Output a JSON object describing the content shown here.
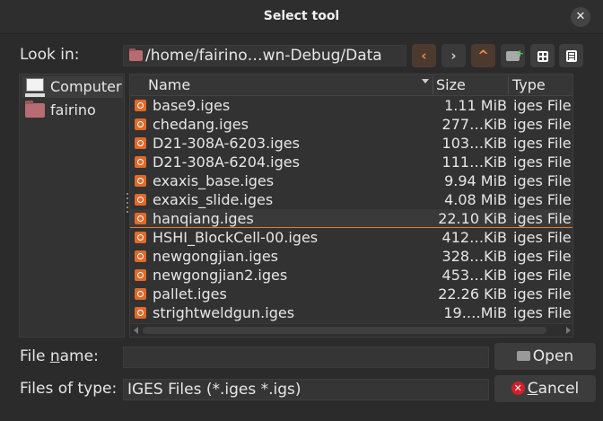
{
  "window": {
    "title": "Select tool"
  },
  "look_in": {
    "label": "Look in:",
    "path": "/home/fairino…wn-Debug/Data"
  },
  "toolbar": {
    "back": "‹",
    "forward": "›",
    "up": "^"
  },
  "sidebar": {
    "items": [
      {
        "label": "Computer",
        "icon": "computer-icon"
      },
      {
        "label": "fairino",
        "icon": "home-folder-icon"
      }
    ]
  },
  "columns": {
    "name": "Name",
    "size": "Size",
    "type": "Type"
  },
  "files": [
    {
      "name": "base9.iges",
      "size": "1.11 MiB",
      "type": "iges File"
    },
    {
      "name": "chedang.iges",
      "size": "277…KiB",
      "type": "iges File"
    },
    {
      "name": "D21-308A-6203.iges",
      "size": "103…KiB",
      "type": "iges File"
    },
    {
      "name": "D21-308A-6204.iges",
      "size": "111…KiB",
      "type": "iges File"
    },
    {
      "name": "exaxis_base.iges",
      "size": "9.94 MiB",
      "type": "iges File"
    },
    {
      "name": "exaxis_slide.iges",
      "size": "4.08 MiB",
      "type": "iges File"
    },
    {
      "name": "hanqiang.iges",
      "size": "22.10 KiB",
      "type": "iges File",
      "selected": true
    },
    {
      "name": "HSHI_BlockCell-00.iges",
      "size": "412…KiB",
      "type": "iges File"
    },
    {
      "name": "newgongjian.iges",
      "size": "328…KiB",
      "type": "iges File"
    },
    {
      "name": "newgongjian2.iges",
      "size": "453…KiB",
      "type": "iges File"
    },
    {
      "name": "pallet.iges",
      "size": "22.26 KiB",
      "type": "iges File"
    },
    {
      "name": "strightweldgun.iges",
      "size": "19.…MiB",
      "type": "iges File"
    }
  ],
  "file_name": {
    "label_pre": "File ",
    "label_mnemonic": "n",
    "label_post": "ame:",
    "value": ""
  },
  "file_type": {
    "label": "Files of type:",
    "value": "IGES Files (*.iges *.igs)"
  },
  "buttons": {
    "open": "Open",
    "cancel_mnemonic": "C",
    "cancel_rest": "ancel"
  },
  "colors": {
    "accent": "#e57a2e",
    "background": "#2b2b2b",
    "file_icon": "#e06a2a"
  }
}
